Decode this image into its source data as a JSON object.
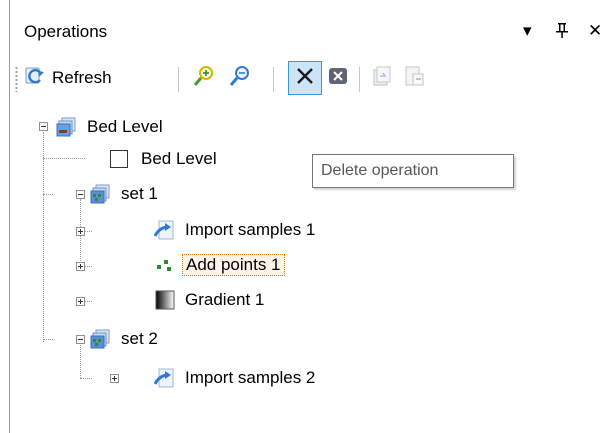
{
  "window": {
    "title": "Operations",
    "dropdown_glyph": "▾",
    "pin_glyph": "ᛘ",
    "close_glyph": "✕"
  },
  "toolbar": {
    "refresh_label": "Refresh",
    "icons": [
      "refresh-icon",
      "zoom-in-icon",
      "zoom-out-icon",
      "delete-icon",
      "remove-icon",
      "copy-icon",
      "paste-icon"
    ],
    "delete_glyph": "✕"
  },
  "tree": {
    "items": [
      {
        "label": "Bed Level",
        "icon": "dataset-icon"
      },
      {
        "label": "Bed Level",
        "icon": "checkbox"
      },
      {
        "label": "set 1",
        "icon": "set-icon"
      },
      {
        "label": "Import samples 1",
        "icon": "import-icon"
      },
      {
        "label": "Add points 1",
        "icon": "add-points-icon",
        "selected": true
      },
      {
        "label": "Gradient 1",
        "icon": "gradient-icon"
      },
      {
        "label": "set 2",
        "icon": "set-icon"
      },
      {
        "label": "Import samples 2",
        "icon": "import-icon"
      }
    ]
  },
  "tooltip": {
    "text": "Delete operation"
  },
  "colors": {
    "selection_border": "#d77a1f",
    "toolbar_active_bg": "#cce4f7",
    "toolbar_active_border": "#3c96dc",
    "icon_blue": "#2f7bd3"
  }
}
